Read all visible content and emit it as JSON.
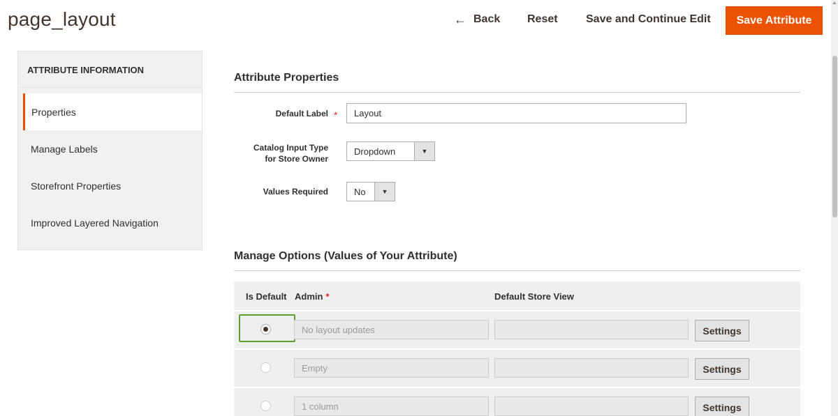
{
  "header": {
    "title": "page_layout",
    "back_label": "Back",
    "back_icon": "arrow-left-icon",
    "reset_label": "Reset",
    "save_continue_label": "Save and Continue Edit",
    "save_label": "Save Attribute",
    "accent_color": "#eb5202"
  },
  "sidebar": {
    "title": "ATTRIBUTE INFORMATION",
    "items": [
      {
        "label": "Properties",
        "active": true
      },
      {
        "label": "Manage Labels",
        "active": false
      },
      {
        "label": "Storefront Properties",
        "active": false
      },
      {
        "label": "Improved Layered Navigation",
        "active": false
      }
    ]
  },
  "attribute_properties": {
    "title": "Attribute Properties",
    "default_label": {
      "label": "Default Label",
      "required_mark": "*",
      "value": "Layout"
    },
    "catalog_input_type": {
      "label_line1": "Catalog Input Type",
      "label_line2": "for Store Owner",
      "value": "Dropdown"
    },
    "values_required": {
      "label": "Values Required",
      "value": "No"
    }
  },
  "manage_options": {
    "title": "Manage Options (Values of Your Attribute)",
    "columns": {
      "is_default": "Is Default",
      "admin": "Admin",
      "admin_required_mark": "*",
      "store_view": "Default Store View"
    },
    "rows": [
      {
        "is_default": true,
        "admin_placeholder": "No layout updates",
        "store_value": "",
        "settings_label": "Settings"
      },
      {
        "is_default": false,
        "admin_placeholder": "Empty",
        "store_value": "",
        "settings_label": "Settings"
      },
      {
        "is_default": false,
        "admin_placeholder": "1 column",
        "store_value": "",
        "settings_label": "Settings"
      }
    ]
  }
}
